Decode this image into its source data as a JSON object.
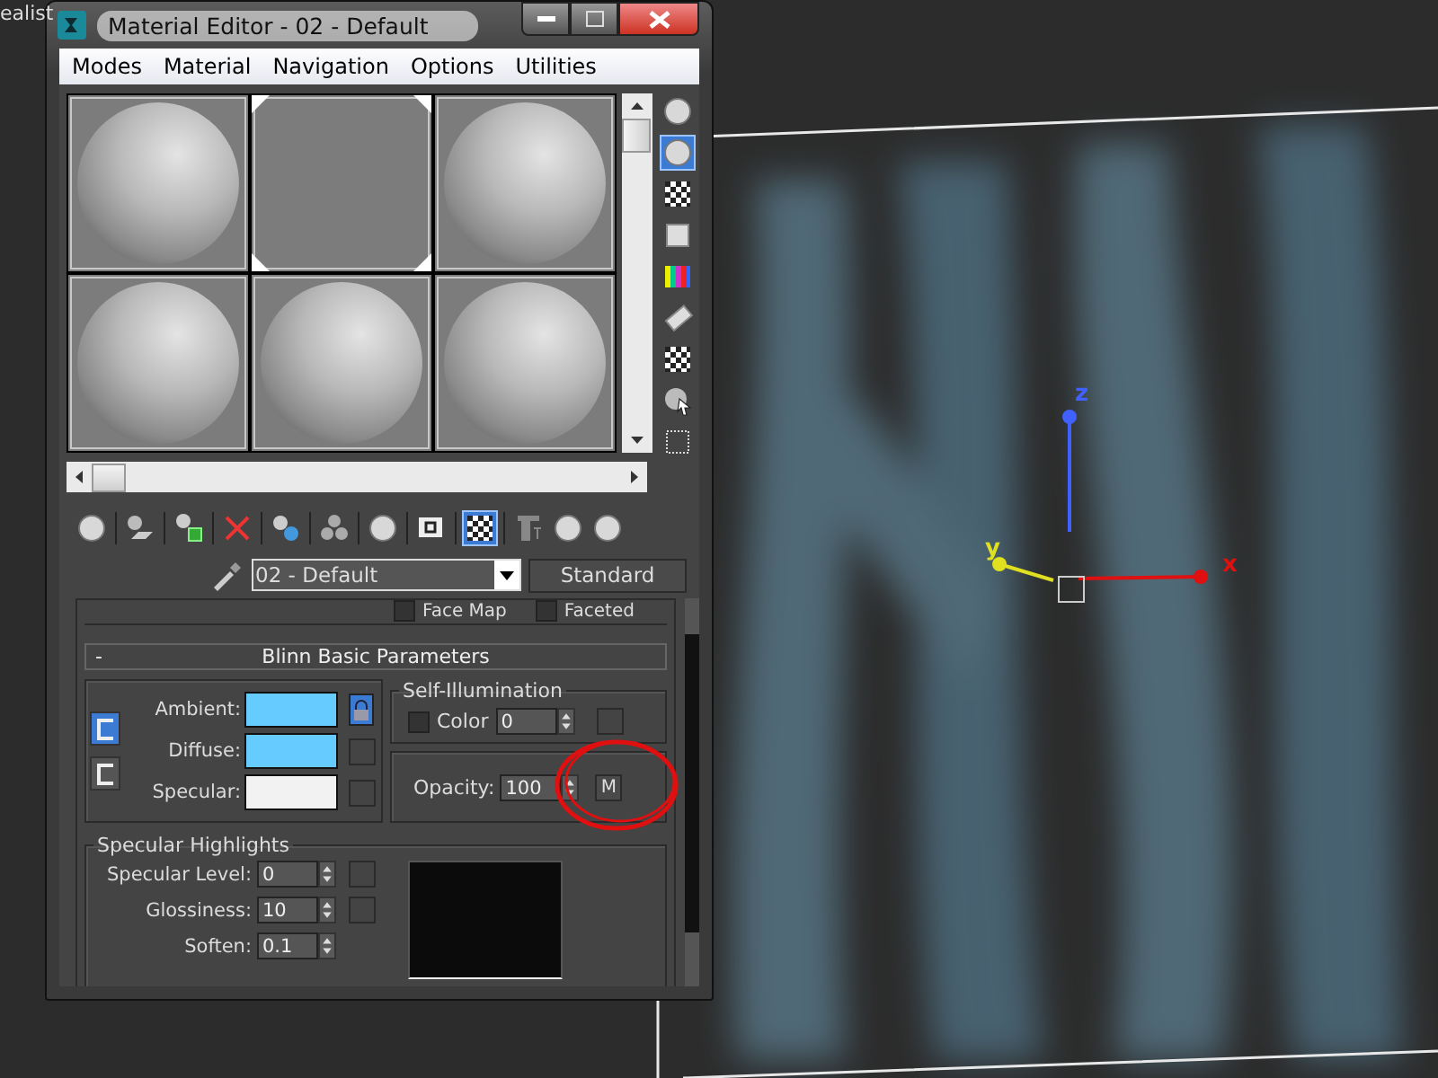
{
  "viewport": {
    "label": "ealist",
    "gizmo_axes": [
      {
        "label": "z",
        "color": "#4060ff"
      },
      {
        "label": "y",
        "color": "#e0e020"
      },
      {
        "label": "x",
        "color": "#e01010"
      }
    ]
  },
  "window": {
    "title": "Material Editor - 02 - Default"
  },
  "menu": [
    {
      "label": "Modes"
    },
    {
      "label": "Material"
    },
    {
      "label": "Navigation"
    },
    {
      "label": "Options"
    },
    {
      "label": "Utilities"
    }
  ],
  "sample_slots": [
    {
      "kind": "sphere",
      "selected": false
    },
    {
      "kind": "blank",
      "selected": true
    },
    {
      "kind": "sphere",
      "selected": false
    },
    {
      "kind": "sphere",
      "selected": false
    },
    {
      "kind": "sphere",
      "selected": false
    },
    {
      "kind": "sphere",
      "selected": false
    }
  ],
  "side_toolbar": [
    {
      "selected": false
    },
    {
      "selected": true
    },
    {
      "selected": false
    },
    {
      "selected": false
    },
    {
      "selected": false
    },
    {
      "selected": false
    },
    {
      "selected": false
    },
    {
      "selected": false
    },
    {
      "selected": false
    }
  ],
  "toolbar": [
    {
      "selected": false
    },
    {
      "selected": false
    },
    {
      "selected": false
    },
    {
      "selected": false
    },
    {
      "selected": false
    },
    {
      "selected": false
    },
    {
      "selected": false
    },
    {
      "selected": false
    },
    {
      "selected": true
    },
    {
      "selected": false
    },
    {
      "selected": false
    },
    {
      "selected": false
    }
  ],
  "material": {
    "name": "02 - Default",
    "type": "Standard"
  },
  "shader_options": [
    {
      "label": "Face Map",
      "checked": false
    },
    {
      "label": "Faceted",
      "checked": false
    }
  ],
  "rollout": {
    "toggle": "-",
    "title": "Blinn Basic Parameters"
  },
  "color_locks": [
    {
      "selected": true
    },
    {
      "selected": false
    }
  ],
  "map_lock": {
    "on": true
  },
  "colors": [
    {
      "label": "Ambient:",
      "color": "#66ccff",
      "map_button": false
    },
    {
      "label": "Diffuse:",
      "color": "#66ccff",
      "map_button": true
    },
    {
      "label": "Specular:",
      "color": "#f2f2f2",
      "map_button": true
    }
  ],
  "self_illumination": {
    "title": "Self-Illumination",
    "checked": false,
    "label": "Color",
    "value": "0"
  },
  "opacity": {
    "label": "Opacity:",
    "value": "100",
    "map_button": "M"
  },
  "specular_highlights": {
    "title": "Specular Highlights",
    "fields": [
      {
        "label": "Specular Level:",
        "value": "0",
        "map_button": true
      },
      {
        "label": "Glossiness:",
        "value": "10",
        "map_button": true
      },
      {
        "label": "Soften:",
        "value": "0.1",
        "map_button": false
      }
    ]
  }
}
